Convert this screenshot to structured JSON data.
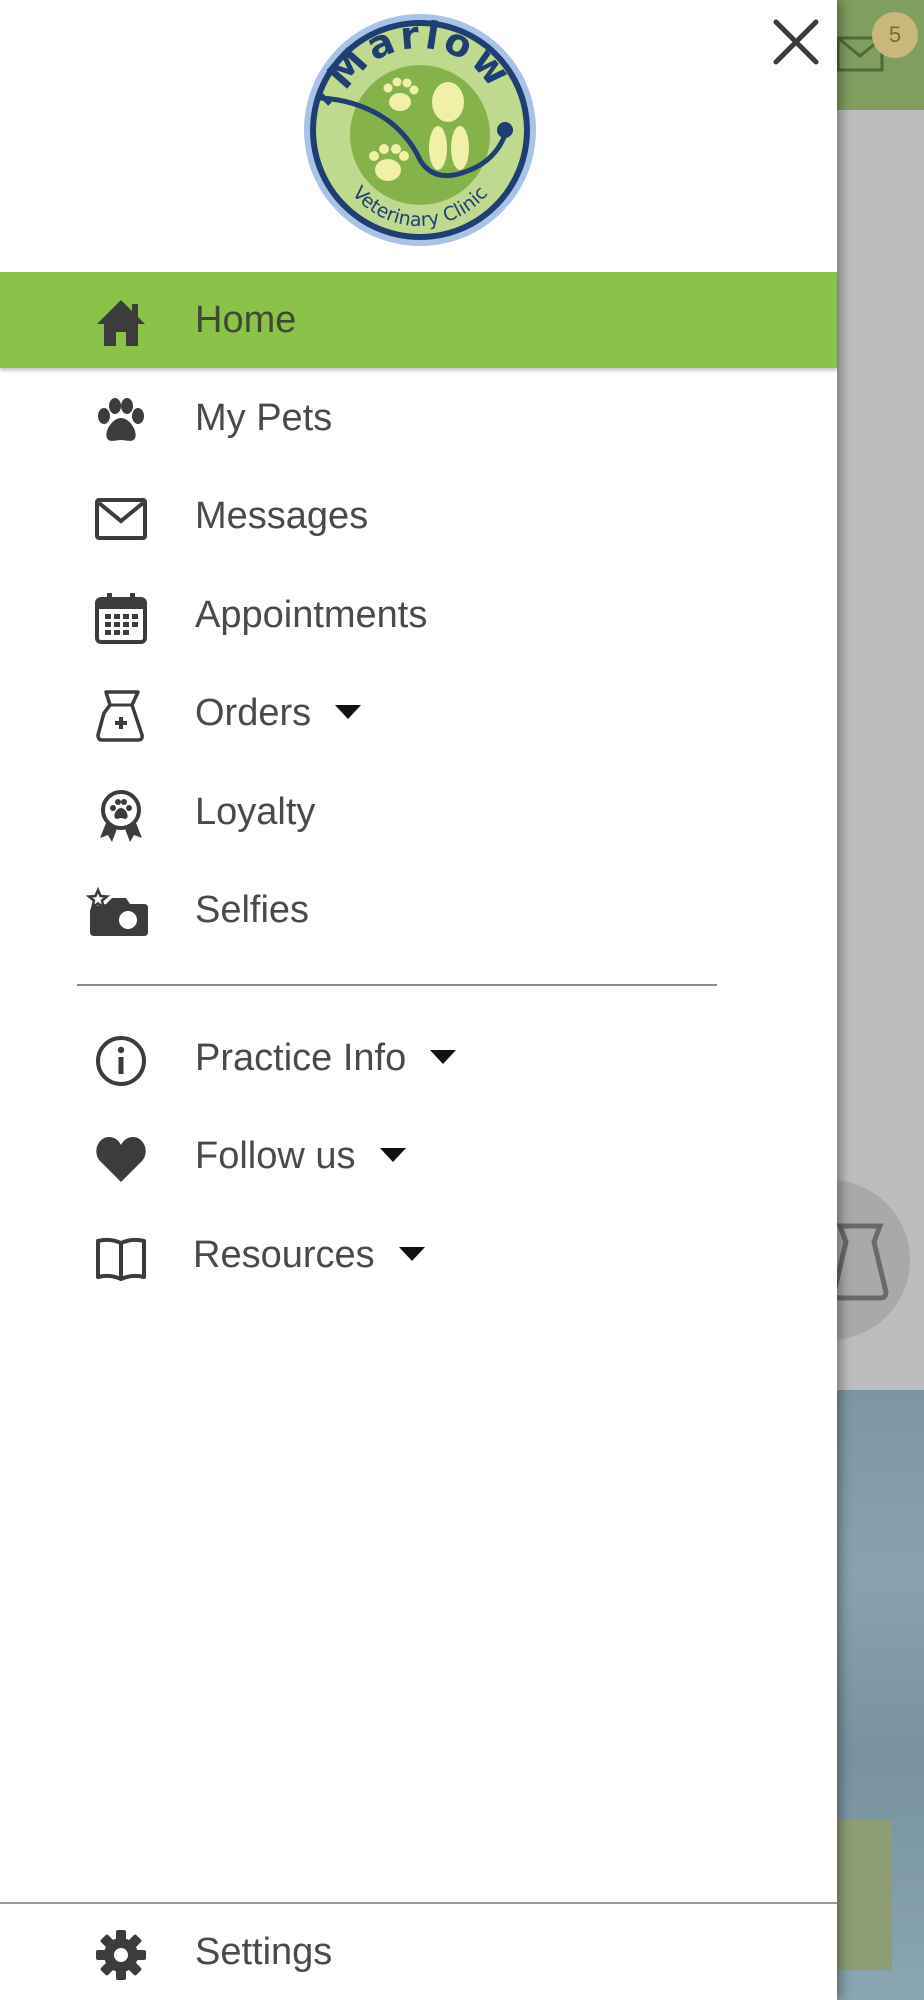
{
  "background": {
    "badge_count": "5",
    "accent_color": "#8bc34a"
  },
  "logo": {
    "text_top": "Marlow",
    "text_bottom": "Veterinary Clinic"
  },
  "nav": {
    "items": [
      {
        "label": "Home",
        "icon": "home-icon",
        "active": true
      },
      {
        "label": "My Pets",
        "icon": "paw-icon"
      },
      {
        "label": "Messages",
        "icon": "envelope-icon"
      },
      {
        "label": "Appointments",
        "icon": "calendar-icon"
      },
      {
        "label": "Orders",
        "icon": "medicine-bag-icon",
        "expandable": true
      },
      {
        "label": "Loyalty",
        "icon": "award-ribbon-icon"
      },
      {
        "label": "Selfies",
        "icon": "camera-icon"
      }
    ],
    "secondary": [
      {
        "label": "Practice Info",
        "icon": "info-icon",
        "expandable": true
      },
      {
        "label": "Follow us",
        "icon": "heart-icon",
        "expandable": true
      },
      {
        "label": "Resources",
        "icon": "book-icon",
        "expandable": true
      }
    ]
  },
  "footer": {
    "settings_label": "Settings",
    "icon": "gear-icon"
  }
}
